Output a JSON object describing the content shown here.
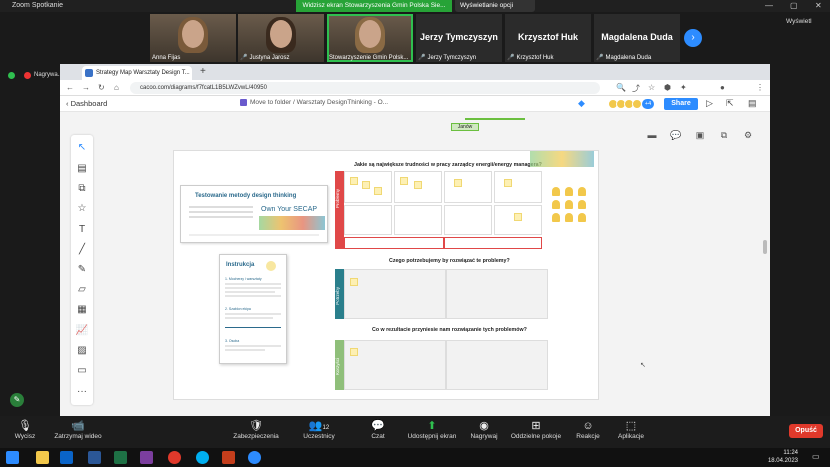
{
  "zoom": {
    "title": "Zoom Spotkanie",
    "share_banner": "Widzisz ekran Stowarzyszenia Gmin Polska Sie...",
    "view_options": "Wyświetlanie opcji",
    "view_label": "Wyświetl",
    "recording": "Nagrywa..."
  },
  "participants": [
    {
      "name": "Anna Fijas",
      "muted": false,
      "video": true
    },
    {
      "name": "Justyna Jarosz",
      "muted": true,
      "video": true
    },
    {
      "name": "Stowarzyszenie Gmin Polsk...",
      "muted": false,
      "video": true,
      "active": true
    },
    {
      "name": "Jerzy Tymczyszyn",
      "muted": true,
      "video": false
    },
    {
      "name": "Krzysztof Huk",
      "muted": true,
      "video": false
    },
    {
      "name": "Magdalena Duda",
      "muted": true,
      "video": false
    }
  ],
  "browser": {
    "tab_title": "Strategy Map Warsztaty Design T...",
    "url": "cacoo.com/diagrams/f7fcatL1B5LWZvwL/40950",
    "new_tab": "+"
  },
  "cacoo": {
    "back_label": "Dashboard",
    "breadcrumb": "Move to folder / Warsztaty DesignThinking - O...",
    "collab_count": "+4",
    "share_label": "Share",
    "janow_label": "Janów"
  },
  "board": {
    "card1_title": "Testowanie metody design thinking",
    "card1_sub": "Own Your SECAP",
    "card2_title": "Instrukcja",
    "card2_section1": "1. Mocherzy i warsztaty",
    "card2_section2": "2. Szablon ekipa",
    "card2_section3": "3. Osoba",
    "q1": "Jakie są największe trudności w pracy zarządcy energii/energy managera?",
    "q2": "Czego potrzebujemy by rozwiązać te problemy?",
    "q3": "Co w rezultacie przyniesie nam rozwiązanie tych problemów?",
    "label1": "Problemy",
    "label2": "Potrzeby",
    "label3": "Korzyści",
    "colors": {
      "red": "#e04848",
      "teal": "#2a7f8c",
      "green": "#8fbf7a"
    }
  },
  "bottom_bar": [
    {
      "label": "Wycisz",
      "icon": "microphone-icon"
    },
    {
      "label": "Zatrzymaj wideo",
      "icon": "camera-icon"
    },
    {
      "label": "Zabezpieczenia",
      "icon": "shield-icon"
    },
    {
      "label": "Uczestnicy",
      "icon": "participants-icon",
      "count": "12"
    },
    {
      "label": "Czat",
      "icon": "chat-icon"
    },
    {
      "label": "Udostępnij ekran",
      "icon": "share-screen-icon",
      "green": true
    },
    {
      "label": "Nagrywaj",
      "icon": "record-icon"
    },
    {
      "label": "Oddzielne pokoje",
      "icon": "rooms-icon"
    },
    {
      "label": "Reakcje",
      "icon": "reaction-icon"
    },
    {
      "label": "Aplikacje",
      "icon": "apps-icon"
    }
  ],
  "leave_label": "Opuść",
  "clock": {
    "time": "11:24",
    "date": "18.04.2023"
  }
}
